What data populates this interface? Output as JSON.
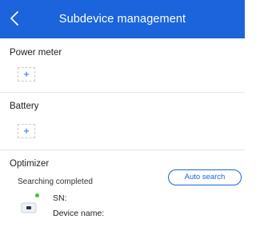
{
  "header": {
    "title": "Subdevice management",
    "back_icon": "chevron-left-icon",
    "background": "#1b64dc"
  },
  "sections": {
    "power_meter": {
      "title": "Power meter",
      "add_label": "+"
    },
    "battery": {
      "title": "Battery",
      "add_label": "+"
    },
    "optimizer": {
      "title": "Optimizer",
      "status": "Searching completed",
      "auto_search_label": "Auto search",
      "device": {
        "icon": "optimizer-device-icon",
        "status_color": "#3ec43e",
        "sn_label": "SN:",
        "name_label": "Device name:"
      }
    }
  },
  "colors": {
    "accent": "#1b64dc",
    "divider": "#e4e6ea",
    "online": "#3ec43e"
  }
}
